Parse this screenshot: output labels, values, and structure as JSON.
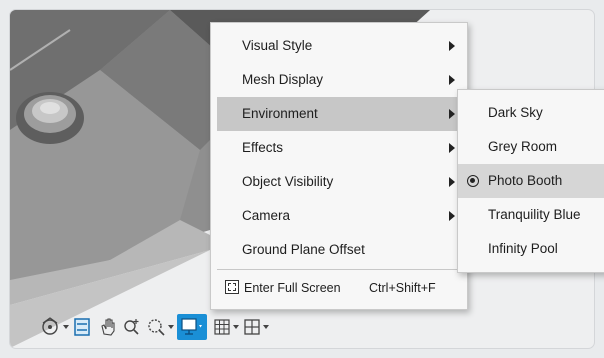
{
  "context_menu": {
    "items": [
      {
        "label": "Visual Style",
        "submenu": true
      },
      {
        "label": "Mesh Display",
        "submenu": true
      },
      {
        "label": "Environment",
        "submenu": true,
        "active": true
      },
      {
        "label": "Effects",
        "submenu": true
      },
      {
        "label": "Object Visibility",
        "submenu": true
      },
      {
        "label": "Camera",
        "submenu": true
      },
      {
        "label": "Ground Plane Offset",
        "submenu": false
      }
    ],
    "full_screen": {
      "label": "Enter Full Screen",
      "shortcut": "Ctrl+Shift+F"
    }
  },
  "environment_submenu": {
    "items": [
      {
        "label": "Dark Sky",
        "selected": false
      },
      {
        "label": "Grey Room",
        "selected": false
      },
      {
        "label": "Photo Booth",
        "selected": true
      },
      {
        "label": "Tranquility Blue",
        "selected": false
      },
      {
        "label": "Infinity Pool",
        "selected": false
      }
    ]
  },
  "toolbar": {
    "buttons": [
      "orbit-icon",
      "look-at-icon",
      "pan-icon",
      "zoom-icon",
      "fit-icon",
      "display-settings-icon",
      "grid-icon",
      "viewports-icon"
    ],
    "active": "display-settings-icon"
  },
  "colors": {
    "accent": "#1a8fd6",
    "menu_bg": "#f7f7f7",
    "active_item": "#c7c7c7"
  }
}
